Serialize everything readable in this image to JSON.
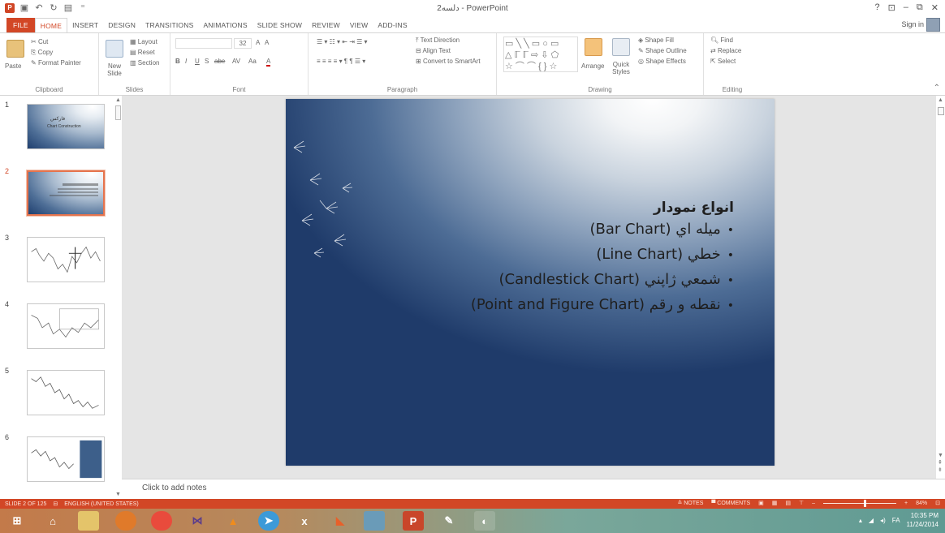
{
  "window": {
    "title": "2دلسه - PowerPoint",
    "controls": [
      "?",
      "⊡",
      "–",
      "⧉",
      "✕"
    ],
    "sign_in": "Sign in"
  },
  "qat": {
    "icons": [
      "powerpoint-icon",
      "save-icon",
      "undo-icon",
      "redo-icon",
      "start-from-beginning-icon",
      "customize-icon"
    ]
  },
  "tabs": [
    "FILE",
    "HOME",
    "INSERT",
    "DESIGN",
    "TRANSITIONS",
    "ANIMATIONS",
    "SLIDE SHOW",
    "REVIEW",
    "VIEW",
    "ADD-INS"
  ],
  "active_tab": "HOME",
  "ribbon": {
    "clipboard": {
      "label": "Clipboard",
      "paste": "Paste",
      "cut": "Cut",
      "copy": "Copy",
      "format_painter": "Format Painter"
    },
    "slides": {
      "label": "Slides",
      "new_slide": "New Slide",
      "layout": "Layout",
      "reset": "Reset",
      "section": "Section"
    },
    "font": {
      "label": "Font",
      "size": "32",
      "bold": "B",
      "italic": "I",
      "underline": "U",
      "strike": "S",
      "shadow": "abe",
      "spacing": "AV",
      "case": "Aa",
      "color": "A",
      "grow": "A",
      "shrink": "A"
    },
    "paragraph": {
      "label": "Paragraph",
      "text_direction": "Text Direction",
      "align_text": "Align Text",
      "convert_smartart": "Convert to SmartArt"
    },
    "drawing": {
      "label": "Drawing",
      "arrange": "Arrange",
      "quick_styles": "Quick Styles",
      "shape_fill": "Shape Fill",
      "shape_outline": "Shape Outline",
      "shape_effects": "Shape Effects"
    },
    "editing": {
      "label": "Editing",
      "find": "Find",
      "replace": "Replace",
      "select": "Select"
    }
  },
  "thumbnails": [
    {
      "num": "1",
      "kind": "title",
      "text_1": "فارکس",
      "text_2": "Chart Construction"
    },
    {
      "num": "2",
      "kind": "title",
      "selected": true
    },
    {
      "num": "3",
      "kind": "chart"
    },
    {
      "num": "4",
      "kind": "chart"
    },
    {
      "num": "5",
      "kind": "chart"
    },
    {
      "num": "6",
      "kind": "chart"
    }
  ],
  "slide": {
    "heading": "انواع نمودار",
    "bullets": [
      "ميله اي (Bar Chart)",
      "خطي (Line Chart)",
      "شمعي ژاپني (Candlestick Chart)",
      "نقطه و رقم (Point and Figure Chart)"
    ]
  },
  "notes_placeholder": "Click to add notes",
  "status": {
    "slide_of": "SLIDE 2 OF 125",
    "language": "ENGLISH (UNITED STATES)",
    "notes": "NOTES",
    "comments": "COMMENTS",
    "zoom": "84%",
    "zoom_fraction": 0.56
  },
  "taskbar": {
    "apps": [
      "start-icon",
      "home-icon",
      "file-explorer-icon",
      "firefox-icon",
      "chrome-icon",
      "visual-studio-icon",
      "vlc-icon",
      "telegram-icon",
      "excel-icon",
      "app-icon",
      "calculator-icon",
      "powerpoint-icon",
      "paint-icon",
      "media-icon"
    ],
    "time": "10:35 PM",
    "date": "11/24/2014",
    "lang": "FA"
  }
}
